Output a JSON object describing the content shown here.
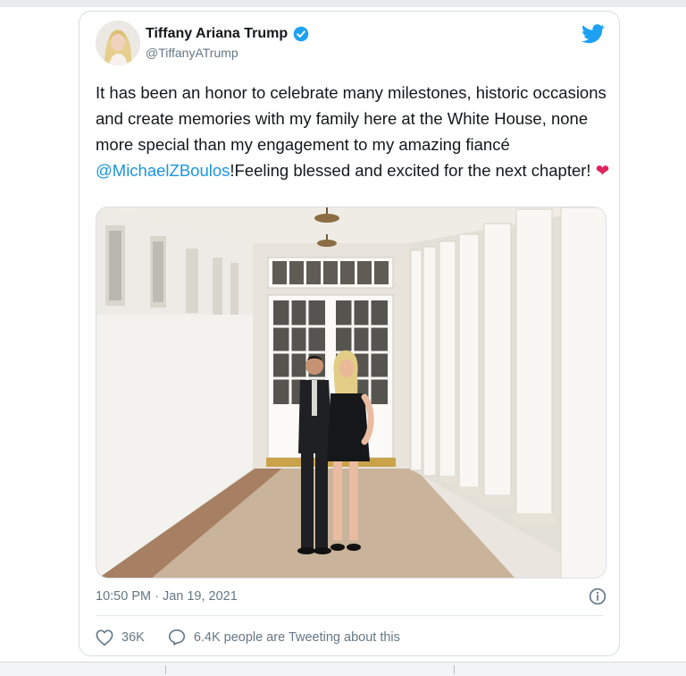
{
  "tweet": {
    "author": {
      "name": "Tiffany Ariana Trump",
      "handle": "@TiffanyATrump",
      "verified_icon": "verified-badge-icon"
    },
    "text": {
      "before_mention": "It has been an honor to celebrate many milestones, historic occasions and create memories with my family here at the White House, none more special than my engagement to my amazing fiancé ",
      "mention": "@MichaelZBoulos",
      "after_mention": "!Feeling blessed and excited for the next chapter! ",
      "emoji": "❤"
    },
    "timestamp": "10:50 PM · Jan 19, 2021",
    "likes": "36K",
    "tweeting_about": "6.4K people are Tweeting about this"
  },
  "colors": {
    "link": "#1b95e0",
    "twitter_blue": "#1da1f2",
    "heart": "#e0245e",
    "muted": "#657786"
  },
  "icons": [
    "twitter-bird-icon",
    "verified-badge-icon",
    "info-icon",
    "heart-icon",
    "comment-icon"
  ]
}
